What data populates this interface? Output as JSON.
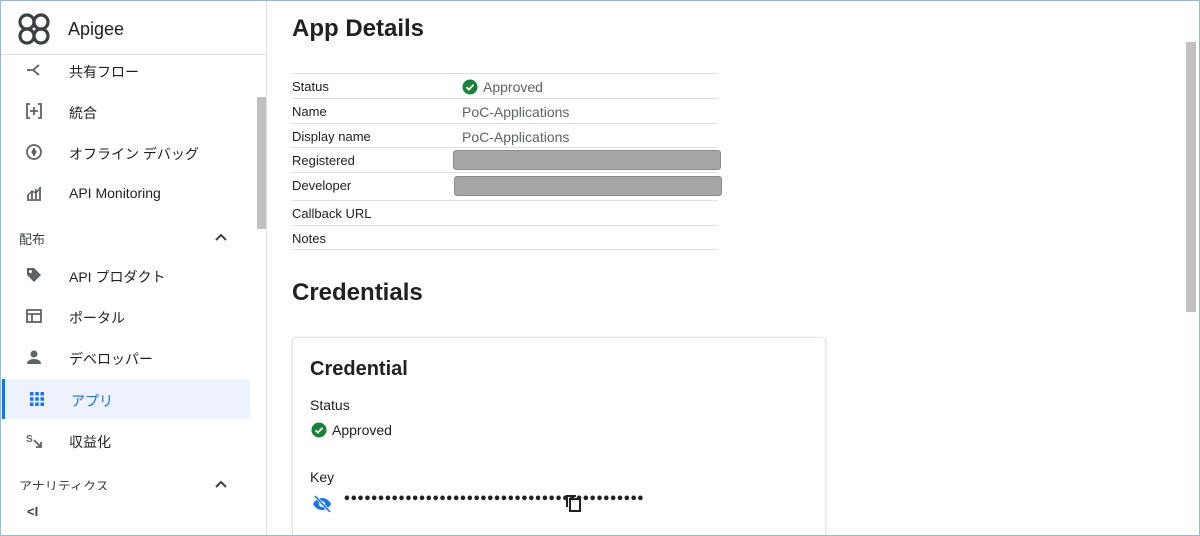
{
  "app": {
    "name": "Apigee"
  },
  "sidebar": {
    "items_top": [
      {
        "label": "共有フロー",
        "icon": "shared-flow-icon"
      },
      {
        "label": "統合",
        "icon": "integration-icon"
      },
      {
        "label": "オフライン デバッグ",
        "icon": "offline-debug-icon"
      },
      {
        "label": "API Monitoring",
        "icon": "api-monitoring-icon"
      }
    ],
    "section_distribution": {
      "label": "配布"
    },
    "items_distribution": [
      {
        "label": "API プロダクト",
        "icon": "tag-icon"
      },
      {
        "label": "ポータル",
        "icon": "portal-icon"
      },
      {
        "label": "デベロッパー",
        "icon": "person-icon"
      },
      {
        "label": "アプリ",
        "icon": "apps-grid-icon",
        "active": true
      },
      {
        "label": "収益化",
        "icon": "monetization-icon"
      }
    ],
    "section_analytics": {
      "label": "アナリティクス"
    },
    "collapse_label": "<I"
  },
  "main": {
    "title": "App Details",
    "details": {
      "status_label": "Status",
      "status_value": "Approved",
      "name_label": "Name",
      "name_value": "PoC-Applications",
      "display_name_label": "Display name",
      "display_name_value": "PoC-Applications",
      "registered_label": "Registered",
      "developer_label": "Developer",
      "callback_label": "Callback URL",
      "notes_label": "Notes"
    },
    "credentials_title": "Credentials",
    "credential": {
      "title": "Credential",
      "status_label": "Status",
      "status_value": "Approved",
      "key_label": "Key",
      "key_masked": "••••••••••••••••••••••••••••••••••••••••••••"
    }
  },
  "colors": {
    "accent": "#1a73e8",
    "approved": "#188038",
    "active_bg": "#edf2fc",
    "redaction": "#a6a6a6"
  }
}
